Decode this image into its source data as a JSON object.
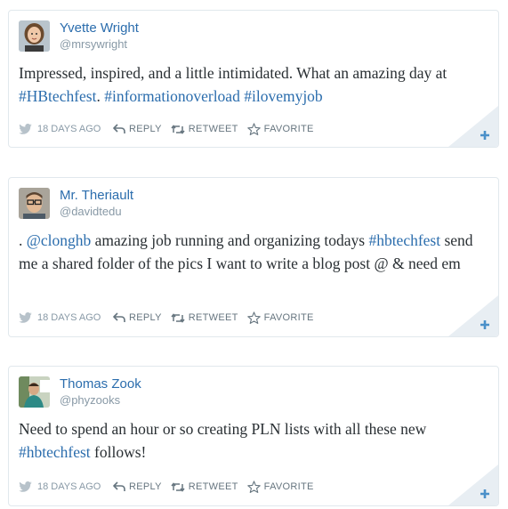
{
  "theme": {
    "link_color": "#2b6dad",
    "muted_color": "#8899a6",
    "text_color": "#292f33",
    "border_color": "#e1e8ed",
    "corner_fill": "#e8eef3",
    "plus_color": "#4a90c9"
  },
  "tweets": [
    {
      "author": "Yvette Wright",
      "handle": "@mrsywright",
      "avatar_icon": "avatar-photo",
      "text": [
        {
          "t": "Impressed, inspired, and a little intimidated. What an amazing day at "
        },
        {
          "t": "#HBtechfest",
          "link": true
        },
        {
          "t": ". "
        },
        {
          "t": "#informationoverload",
          "link": true
        },
        {
          "t": " "
        },
        {
          "t": "#ilovemyjob",
          "link": true
        }
      ],
      "timestamp": "18 DAYS AGO",
      "actions": {
        "reply": "REPLY",
        "retweet": "RETWEET",
        "favorite": "FAVORITE"
      }
    },
    {
      "author": "Mr. Theriault",
      "handle": "@davidtedu",
      "avatar_icon": "avatar-photo",
      "text": [
        {
          "t": ". "
        },
        {
          "t": "@clonghb",
          "link": true
        },
        {
          "t": " amazing job running and organizing todays "
        },
        {
          "t": "#hbtechfest",
          "link": true
        },
        {
          "t": " send me a shared folder of the pics I want to write a blog post @ & need em"
        }
      ],
      "timestamp": "18 DAYS AGO",
      "actions": {
        "reply": "REPLY",
        "retweet": "RETWEET",
        "favorite": "FAVORITE"
      }
    },
    {
      "author": "Thomas Zook",
      "handle": "@phyzooks",
      "avatar_icon": "avatar-photo",
      "text": [
        {
          "t": "Need to spend an hour or so creating PLN lists with all these new "
        },
        {
          "t": "#hbtechfest",
          "link": true
        },
        {
          "t": " follows!"
        }
      ],
      "timestamp": "18 DAYS AGO",
      "actions": {
        "reply": "REPLY",
        "retweet": "RETWEET",
        "favorite": "FAVORITE"
      }
    }
  ]
}
